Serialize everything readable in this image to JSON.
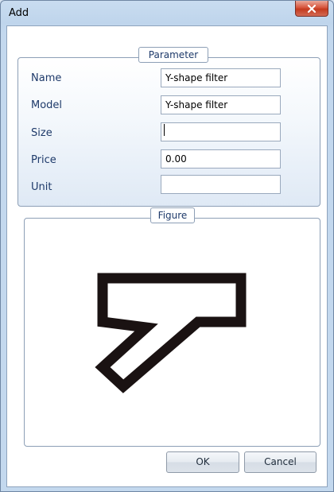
{
  "window": {
    "title": "Add",
    "close_icon": "close-icon"
  },
  "parameter": {
    "legend": "Parameter",
    "fields": [
      {
        "label": "Name",
        "value": ""
      },
      {
        "label": "Model",
        "value": "Y-shape filter"
      },
      {
        "label": "Size",
        "value": ""
      },
      {
        "label": "Price",
        "value": "0.00"
      },
      {
        "label": "Unit",
        "value": ""
      }
    ],
    "name_value": "Y-shape filter"
  },
  "figure": {
    "legend": "Figure",
    "image_icon": "y-shape-filter-icon"
  },
  "buttons": {
    "ok": "OK",
    "cancel": "Cancel"
  }
}
